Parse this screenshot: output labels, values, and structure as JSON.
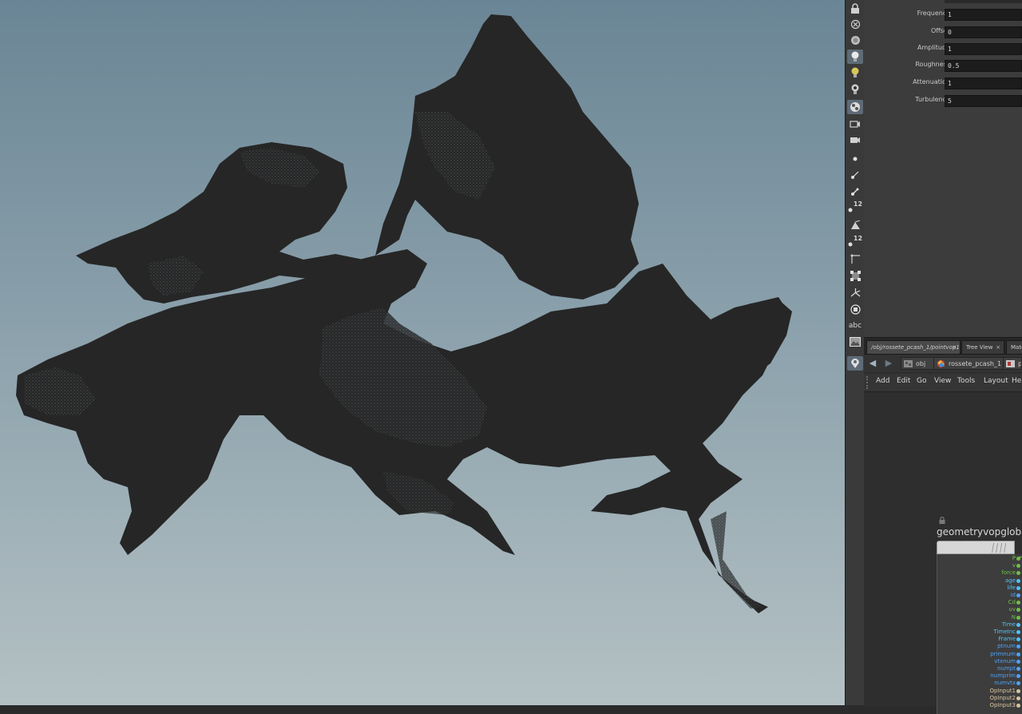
{
  "parameters": [
    {
      "label": "Frequency",
      "value": "1"
    },
    {
      "label": "Offset",
      "value": "0"
    },
    {
      "label": "Amplitude",
      "value": "1"
    },
    {
      "label": "Roughness",
      "value": "0.5"
    },
    {
      "label": "Attenuation",
      "value": "1"
    },
    {
      "label": "Turbulence",
      "value": "5"
    }
  ],
  "shelf": {
    "tools": [
      {
        "icon": "lock-icon"
      },
      {
        "icon": "ghost-off-icon"
      },
      {
        "icon": "display-icon"
      },
      {
        "icon": "light-icon",
        "active": true
      },
      {
        "icon": "light-add-icon"
      },
      {
        "icon": "light-select-icon"
      },
      {
        "icon": "render-icon",
        "active": true
      },
      {
        "icon": "camera-icon"
      },
      {
        "icon": "camera-view-icon"
      },
      {
        "icon": "point-icon"
      },
      {
        "icon": "vector-icon"
      },
      {
        "icon": "normal-icon"
      },
      {
        "icon": "point-number-icon",
        "text": "12"
      },
      {
        "icon": "primitive-icon"
      },
      {
        "icon": "primitive-number-icon",
        "text": "12"
      },
      {
        "icon": "hull-icon"
      },
      {
        "icon": "bounding-box-icon"
      },
      {
        "icon": "snap-icon"
      },
      {
        "icon": "attribute-icon"
      },
      {
        "icon": "text-icon",
        "text": "abc"
      },
      {
        "icon": "background-image-icon"
      },
      {
        "icon": "handle-icon",
        "active": true
      }
    ]
  },
  "network": {
    "tabs": [
      {
        "label": "/obj/rossete_pcash_1/pointvop1",
        "close": "×",
        "active": true
      },
      {
        "label": "Tree View",
        "close": "×"
      },
      {
        "label": "Mate",
        "close": ""
      }
    ],
    "path": [
      {
        "label": "obj"
      },
      {
        "label": "rossete_pcash_1"
      },
      {
        "label": "p"
      }
    ],
    "menu": [
      "Add",
      "Edit",
      "Go",
      "View",
      "Tools",
      "Layout",
      "He"
    ],
    "node": {
      "title": "geometryvopgloba",
      "ports": [
        {
          "name": "P",
          "color": "#6fbf4a"
        },
        {
          "name": "v",
          "color": "#6fbf4a"
        },
        {
          "name": "force",
          "color": "#6fbf4a"
        },
        {
          "name": "age",
          "color": "#4fc3f7"
        },
        {
          "name": "life",
          "color": "#4fc3f7"
        },
        {
          "name": "id",
          "color": "#4fa3f7"
        },
        {
          "name": "Cd",
          "color": "#6fbf4a"
        },
        {
          "name": "uv",
          "color": "#6fbf4a"
        },
        {
          "name": "N",
          "color": "#6fbf4a"
        },
        {
          "name": "Time",
          "color": "#4fc3f7"
        },
        {
          "name": "TimeInc",
          "color": "#4fc3f7"
        },
        {
          "name": "Frame",
          "color": "#4fc3f7"
        },
        {
          "name": "ptnum",
          "color": "#4fa3f7"
        },
        {
          "name": "primnum",
          "color": "#4fa3f7"
        },
        {
          "name": "vtxnum",
          "color": "#4fa3f7"
        },
        {
          "name": "numpt",
          "color": "#4fa3f7"
        },
        {
          "name": "numprim",
          "color": "#4fa3f7"
        },
        {
          "name": "numvtx",
          "color": "#4fa3f7"
        },
        {
          "name": "OpInput1",
          "color": "#d9c4a0"
        },
        {
          "name": "OpInput2",
          "color": "#d9c4a0"
        },
        {
          "name": "OpInput3",
          "color": "#d9c4a0"
        }
      ]
    }
  },
  "colors": {
    "viewport_top": "#6a8595",
    "viewport_bottom": "#b4c1c4",
    "geometry": "#262626"
  }
}
